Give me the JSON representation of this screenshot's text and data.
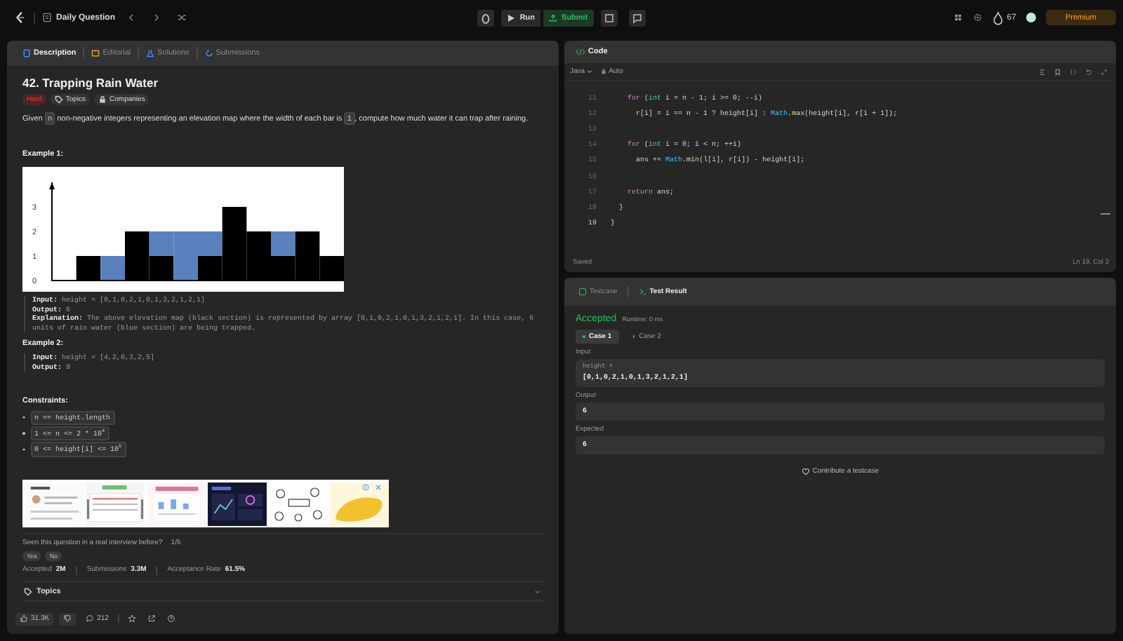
{
  "top_bar": {
    "title": "Daily Question",
    "run": "Run",
    "submit": "Submit",
    "streak": "67",
    "premium": "Premium"
  },
  "left_tabs": [
    {
      "label": "Description",
      "selected": true
    },
    {
      "label": "Editorial",
      "selected": false
    },
    {
      "label": "Solutions",
      "selected": false
    },
    {
      "label": "Submissions",
      "selected": false
    }
  ],
  "problem": {
    "title": "42. Trapping Rain Water",
    "difficulty": "Hard",
    "tags": [
      "Topics",
      "Companies"
    ],
    "description": [
      {
        "text": "Given ",
        "code": false
      },
      {
        "text": "n",
        "code": true
      },
      {
        "text": " non-negative integers representing an elevation map where the width of each bar is ",
        "code": false
      },
      {
        "text": "1",
        "code": true
      },
      {
        "text": ", compute how much water it can trap after raining.",
        "code": false
      }
    ],
    "examples": [
      {
        "title": "Example 1:",
        "chart_data": {
          "type": "bar",
          "stacked": true,
          "ylim": [
            0,
            4
          ],
          "yticks": [
            0,
            1,
            2,
            3
          ],
          "series": [
            {
              "color": "#000000",
              "values": [
                0,
                1,
                0,
                2,
                1,
                0,
                1,
                3,
                2,
                1,
                2,
                1
              ]
            },
            {
              "color": "#5a81be",
              "values": [
                0,
                0,
                1,
                0,
                1,
                2,
                1,
                0,
                0,
                1,
                0,
                0
              ]
            }
          ]
        },
        "lines": [
          "**Input:** height = [0,1,0,2,1,0,1,3,2,1,2,1]",
          "**Output:** 6",
          "**Explanation:** The above elevation map (black section) is represented by array [0,1,0,2,1,0,1,3,2,1,2,1]. In this case, 6 units of rain water (blue section) are being trapped."
        ]
      },
      {
        "title": "Example 2:",
        "lines": [
          "**Input:** height = [4,2,0,3,2,5]",
          "**Output:** 9"
        ]
      }
    ],
    "constraints_title": "Constraints:",
    "constraints": [
      "n == height.length",
      "1 <= n <= 2 * 10$^{4}$",
      "0 <= height[i] <= 10$^{5}$"
    ],
    "ad": {
      "images": [
        {
          "kind": "picture"
        },
        {
          "kind": "picture"
        },
        {
          "kind": "picture"
        },
        {
          "kind": "picture"
        },
        {
          "kind": "picture"
        },
        {
          "kind": "picture"
        }
      ]
    },
    "interview": {
      "question": "Seen this question in a real interview before?",
      "count": "1/5",
      "answers": [
        "Yes",
        "No"
      ]
    },
    "stats": [
      {
        "label": "Accepted",
        "value": "2M"
      },
      {
        "label": "Submissions",
        "value": "3.3M"
      },
      {
        "label": "Acceptance Rate",
        "value": "61.5%"
      }
    ],
    "topics": {
      "label": "Topics",
      "expanded": false
    },
    "footer": {
      "likes": "31.3K",
      "comments": "212"
    }
  },
  "code_panel": {
    "title": "Code",
    "language": "Java",
    "mode": "Auto",
    "lines": [
      {
        "number": "11",
        "tokens": [
          {
            "text": "    for",
            "kind": "keyword"
          },
          {
            "text": " (",
            "kind": "plain"
          },
          {
            "text": "int",
            "kind": "type"
          },
          {
            "text": " i = n - 1; i >= 0; --i)",
            "kind": "plain"
          }
        ]
      },
      {
        "number": "12",
        "tokens": [
          {
            "text": "      r[i] = i == n - 1 ? height[i] : ",
            "kind": "plain"
          },
          {
            "text": "Math",
            "kind": "class"
          },
          {
            "text": ".",
            "kind": "plain"
          },
          {
            "text": "max",
            "kind": "method"
          },
          {
            "text": "(height[i], r[i + 1]);",
            "kind": "plain"
          }
        ]
      },
      {
        "number": "13"
      },
      {
        "number": "14",
        "tokens": [
          {
            "text": "    for",
            "kind": "keyword"
          },
          {
            "text": " (",
            "kind": "plain"
          },
          {
            "text": "int",
            "kind": "type"
          },
          {
            "text": " i = 0; i < n; ++i)",
            "kind": "plain"
          }
        ]
      },
      {
        "number": "15",
        "tokens": [
          {
            "text": "      ans += ",
            "kind": "plain"
          },
          {
            "text": "Math",
            "kind": "class"
          },
          {
            "text": ".",
            "kind": "plain"
          },
          {
            "text": "min",
            "kind": "method"
          },
          {
            "text": "(l[i], r[i]) - height[i];",
            "kind": "plain"
          }
        ]
      },
      {
        "number": "16"
      },
      {
        "number": "17",
        "tokens": [
          {
            "text": "    return",
            "kind": "keyword"
          },
          {
            "text": " ans;",
            "kind": "plain"
          }
        ]
      },
      {
        "number": "18",
        "tokens": [
          {
            "text": "  }",
            "kind": "plain"
          }
        ]
      },
      {
        "number": "19",
        "tokens": [
          {
            "text": "}",
            "kind": "plain"
          }
        ]
      }
    ],
    "status": "Saved",
    "cursor": "Ln 19, Col 2"
  },
  "result_panel": {
    "tabs": [
      {
        "label": "Testcase",
        "selected": false
      },
      {
        "label": "Test Result",
        "selected": true
      }
    ],
    "verdict": "Accepted",
    "runtime": "Runtime: 0 ms",
    "cases": [
      {
        "label": "Case 1",
        "selected": true
      },
      {
        "label": "Case 2",
        "selected": false
      }
    ],
    "fields": [
      {
        "label": "Input",
        "name": "height =",
        "value": "[0,1,0,2,1,0,1,3,2,1,2,1]"
      },
      {
        "label": "Output",
        "value": "6"
      },
      {
        "label": "Expected",
        "value": "6"
      }
    ],
    "contribute": "Contribute a testcase"
  }
}
